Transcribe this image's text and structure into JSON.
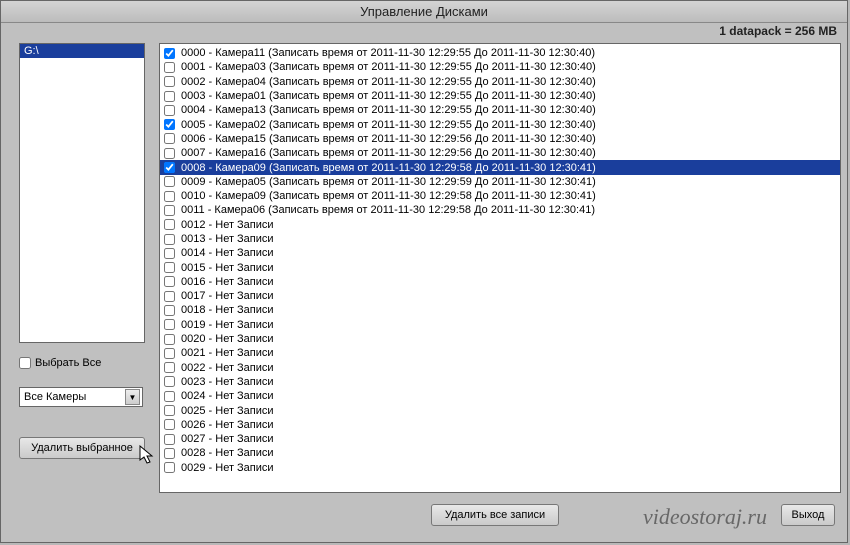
{
  "title": "Управление Дисками",
  "datapack_info": "1 datapack = 256 MB",
  "drives": [
    "G:\\"
  ],
  "select_all_label": "Выбрать Все",
  "select_all_checked": false,
  "camera_filter": "Все Камеры",
  "delete_selected_label": "Удалить выбранное",
  "delete_all_label": "Удалить все записи",
  "exit_label": "Выход",
  "watermark": "videostoraj.ru",
  "records": [
    {
      "id": "0000",
      "camera": "Камера11",
      "checked": true,
      "selected": false,
      "text": "(Записать время от 2011-11-30 12:29:55 До 2011-11-30 12:30:40)"
    },
    {
      "id": "0001",
      "camera": "Камера03",
      "checked": false,
      "selected": false,
      "text": "(Записать время от 2011-11-30 12:29:55 До 2011-11-30 12:30:40)"
    },
    {
      "id": "0002",
      "camera": "Камера04",
      "checked": false,
      "selected": false,
      "text": "(Записать время от 2011-11-30 12:29:55 До 2011-11-30 12:30:40)"
    },
    {
      "id": "0003",
      "camera": "Камера01",
      "checked": false,
      "selected": false,
      "text": "(Записать время от 2011-11-30 12:29:55 До 2011-11-30 12:30:40)"
    },
    {
      "id": "0004",
      "camera": "Камера13",
      "checked": false,
      "selected": false,
      "text": "(Записать время от 2011-11-30 12:29:55 До 2011-11-30 12:30:40)"
    },
    {
      "id": "0005",
      "camera": "Камера02",
      "checked": true,
      "selected": false,
      "text": "(Записать время от 2011-11-30 12:29:55 До 2011-11-30 12:30:40)"
    },
    {
      "id": "0006",
      "camera": "Камера15",
      "checked": false,
      "selected": false,
      "text": "(Записать время от 2011-11-30 12:29:56 До 2011-11-30 12:30:40)"
    },
    {
      "id": "0007",
      "camera": "Камера16",
      "checked": false,
      "selected": false,
      "text": "(Записать время от 2011-11-30 12:29:56 До 2011-11-30 12:30:40)"
    },
    {
      "id": "0008",
      "camera": "Камера09",
      "checked": true,
      "selected": true,
      "text": "(Записать время от 2011-11-30 12:29:58 До 2011-11-30 12:30:41)"
    },
    {
      "id": "0009",
      "camera": "Камера05",
      "checked": false,
      "selected": false,
      "text": "(Записать время от 2011-11-30 12:29:59 До 2011-11-30 12:30:41)"
    },
    {
      "id": "0010",
      "camera": "Камера09",
      "checked": false,
      "selected": false,
      "text": "(Записать время от 2011-11-30 12:29:58 До 2011-11-30 12:30:41)"
    },
    {
      "id": "0011",
      "camera": "Камера06",
      "checked": false,
      "selected": false,
      "text": "(Записать время от 2011-11-30 12:29:58 До 2011-11-30 12:30:41)"
    },
    {
      "id": "0012",
      "camera": "Нет Записи",
      "checked": false,
      "selected": false,
      "text": ""
    },
    {
      "id": "0013",
      "camera": "Нет Записи",
      "checked": false,
      "selected": false,
      "text": ""
    },
    {
      "id": "0014",
      "camera": "Нет Записи",
      "checked": false,
      "selected": false,
      "text": ""
    },
    {
      "id": "0015",
      "camera": "Нет Записи",
      "checked": false,
      "selected": false,
      "text": ""
    },
    {
      "id": "0016",
      "camera": "Нет Записи",
      "checked": false,
      "selected": false,
      "text": ""
    },
    {
      "id": "0017",
      "camera": "Нет Записи",
      "checked": false,
      "selected": false,
      "text": ""
    },
    {
      "id": "0018",
      "camera": "Нет Записи",
      "checked": false,
      "selected": false,
      "text": ""
    },
    {
      "id": "0019",
      "camera": "Нет Записи",
      "checked": false,
      "selected": false,
      "text": ""
    },
    {
      "id": "0020",
      "camera": "Нет Записи",
      "checked": false,
      "selected": false,
      "text": ""
    },
    {
      "id": "0021",
      "camera": "Нет Записи",
      "checked": false,
      "selected": false,
      "text": ""
    },
    {
      "id": "0022",
      "camera": "Нет Записи",
      "checked": false,
      "selected": false,
      "text": ""
    },
    {
      "id": "0023",
      "camera": "Нет Записи",
      "checked": false,
      "selected": false,
      "text": ""
    },
    {
      "id": "0024",
      "camera": "Нет Записи",
      "checked": false,
      "selected": false,
      "text": ""
    },
    {
      "id": "0025",
      "camera": "Нет Записи",
      "checked": false,
      "selected": false,
      "text": ""
    },
    {
      "id": "0026",
      "camera": "Нет Записи",
      "checked": false,
      "selected": false,
      "text": ""
    },
    {
      "id": "0027",
      "camera": "Нет Записи",
      "checked": false,
      "selected": false,
      "text": ""
    },
    {
      "id": "0028",
      "camera": "Нет Записи",
      "checked": false,
      "selected": false,
      "text": ""
    },
    {
      "id": "0029",
      "camera": "Нет Записи",
      "checked": false,
      "selected": false,
      "text": ""
    }
  ]
}
